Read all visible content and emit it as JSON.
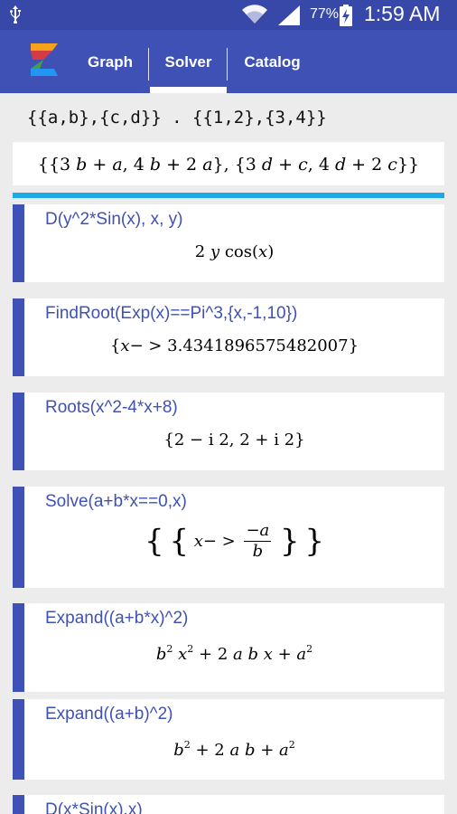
{
  "status_bar": {
    "battery_percent": "77%",
    "time": "1:59 AM"
  },
  "app_bar": {
    "logo": "app-logo",
    "tabs": [
      {
        "label": "Graph",
        "selected": false
      },
      {
        "label": "Solver",
        "selected": true
      },
      {
        "label": "Catalog",
        "selected": false
      }
    ]
  },
  "input": {
    "value": "{{a,b},{c,d}} . {{1,2},{3,4}}"
  },
  "current_result": {
    "parts": [
      "{{3 ",
      "b",
      " + ",
      "a",
      ", 4 ",
      "b",
      " + 2 ",
      "a",
      "}, {3 ",
      "d",
      "  + ",
      "c",
      ", 4 ",
      "d",
      "  + 2 ",
      "c",
      "}}"
    ]
  },
  "history": [
    {
      "query": "D(y^2*Sin(x), x, y)",
      "result": {
        "pre": "2 ",
        "var": "y",
        "post": " cos(",
        "arg": "x",
        "end": ")"
      }
    },
    {
      "query": "FindRoot(Exp(x)==Pi^3,{x,-1,10})",
      "result": {
        "open": "{",
        "var": "x",
        "arrow": "− > 3.4341896575482007",
        "close": "}"
      }
    },
    {
      "query": "Roots(x^2-4*x+8)",
      "result": {
        "text": "{2 − i  2, 2 + i  2}"
      }
    },
    {
      "query": "Solve(a+b*x==0,x)",
      "result": {
        "open": "{",
        "inner_open": "{",
        "var": "x",
        "arrow": "− >",
        "numerator": "−a",
        "denominator": "b",
        "inner_close": "}",
        "close": "}"
      }
    },
    {
      "query": "Expand((a+b*x)^2)",
      "result": {
        "b": "b",
        "exp1": "2",
        "x": "x",
        "exp2": "2",
        "mid": " + 2 ",
        "a1": "a",
        "b2": " b ",
        "x2": "x",
        "plus": " + ",
        "a2": "a",
        "exp3": "2"
      }
    },
    {
      "query": "Expand((a+b)^2)",
      "result": {
        "b": "b",
        "exp1": "2",
        "mid": " + 2 ",
        "a1": "a",
        "b2": " b",
        "plus": " + ",
        "a2": "a",
        "exp2": "2"
      }
    },
    {
      "query": "D(x*Sin(x),x)"
    }
  ]
}
